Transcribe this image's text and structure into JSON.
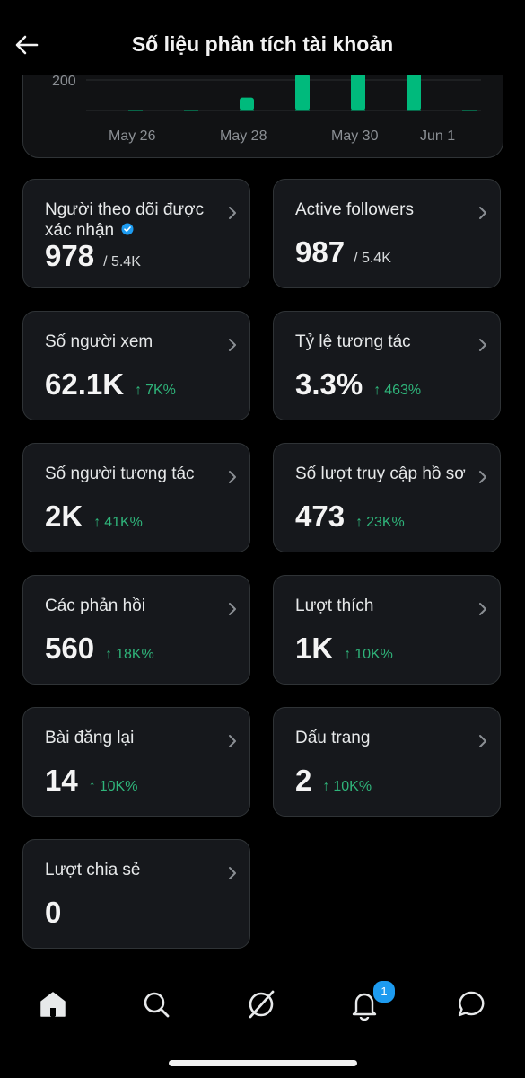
{
  "header": {
    "title": "Số liệu phân tích tài khoản",
    "back_icon": "arrow-left-icon"
  },
  "chart_data": {
    "type": "bar",
    "x_tick_labels": [
      "May 26",
      "May 28",
      "May 30",
      "Jun 1"
    ],
    "y_tick_labels": [
      "200"
    ],
    "bar_color": "#00ba7c",
    "series": [
      {
        "x": "May 28",
        "value": 130
      },
      {
        "x": "May 29",
        "value": 185
      },
      {
        "x": "May 30",
        "value": 250
      },
      {
        "x": "May 31",
        "value": 250
      }
    ],
    "ylim": [
      100,
      250
    ],
    "grid": true
  },
  "cards": [
    {
      "label": "Người theo dõi được xác nhận",
      "value": "978",
      "denom": "/ 5.4K",
      "change": "",
      "verified": true
    },
    {
      "label": "Active followers",
      "value": "987",
      "denom": "/ 5.4K",
      "change": "",
      "verified": false
    },
    {
      "label": "Số người xem",
      "value": "62.1K",
      "denom": "",
      "change": "7K%"
    },
    {
      "label": "Tỷ lệ tương tác",
      "value": "3.3%",
      "denom": "",
      "change": "463%"
    },
    {
      "label": "Số người tương tác",
      "value": "2K",
      "denom": "",
      "change": "41K%"
    },
    {
      "label": "Số lượt truy cập hồ sơ",
      "value": "473",
      "denom": "",
      "change": "23K%"
    },
    {
      "label": "Các phản hồi",
      "value": "560",
      "denom": "",
      "change": "18K%"
    },
    {
      "label": "Lượt thích",
      "value": "1K",
      "denom": "",
      "change": "10K%"
    },
    {
      "label": "Bài đăng lại",
      "value": "14",
      "denom": "",
      "change": "10K%"
    },
    {
      "label": "Dấu trang",
      "value": "2",
      "denom": "",
      "change": "10K%"
    },
    {
      "label": "Lượt chia sẻ",
      "value": "0",
      "denom": "",
      "change": ""
    }
  ],
  "colors": {
    "background": "#000000",
    "card": "#16181c",
    "positive": "#2fb47a",
    "accent": "#1d9bf0"
  },
  "nav": {
    "items": [
      "home-icon",
      "search-icon",
      "grok-icon",
      "notifications-icon",
      "messages-icon"
    ],
    "notifications_badge": "1"
  }
}
